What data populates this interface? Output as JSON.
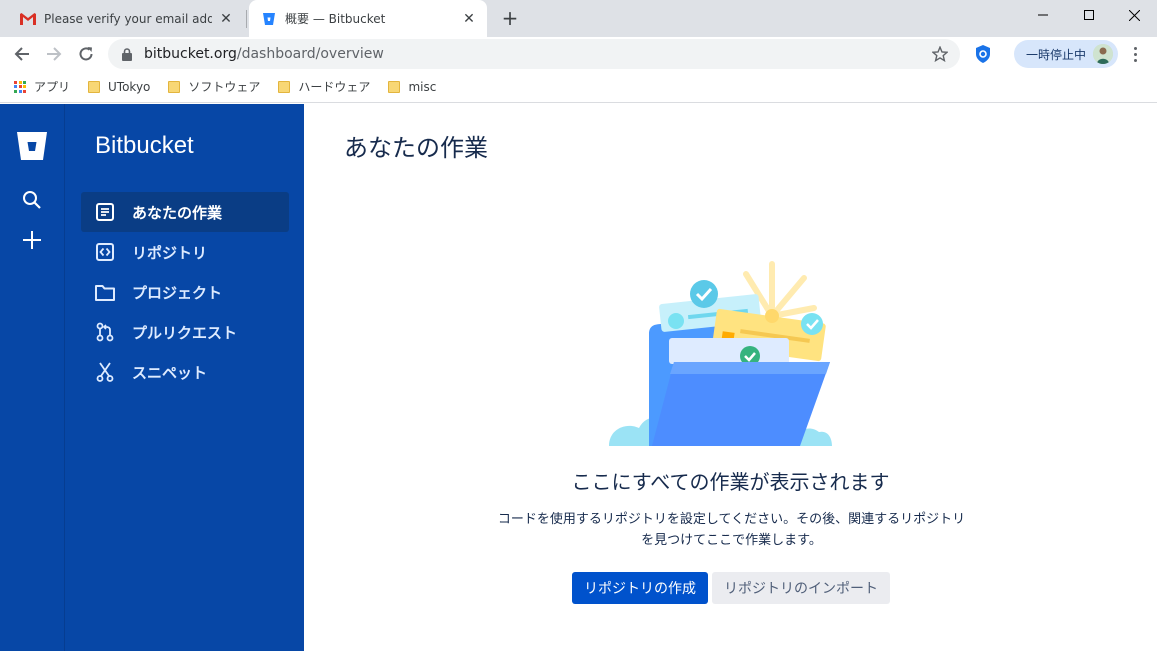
{
  "browser": {
    "tabs": [
      {
        "title": "Please verify your email address",
        "active": false,
        "favicon": "gmail-icon"
      },
      {
        "title": "概要 — Bitbucket",
        "active": true,
        "favicon": "bitbucket-icon"
      }
    ],
    "url": {
      "domain": "bitbucket.org",
      "path": "/dashboard/overview"
    },
    "profile_label": "一時停止中",
    "bookmarks": [
      {
        "label": "アプリ",
        "icon": "apps-grid-icon"
      },
      {
        "label": "UTokyo",
        "icon": "folder-icon"
      },
      {
        "label": "ソフトウェア",
        "icon": "folder-icon"
      },
      {
        "label": "ハードウェア",
        "icon": "folder-icon"
      },
      {
        "label": "misc",
        "icon": "folder-icon"
      }
    ]
  },
  "app": {
    "product_name": "Bitbucket",
    "sidebar": {
      "items": [
        {
          "label": "あなたの作業",
          "icon": "document-icon",
          "selected": true
        },
        {
          "label": "リポジトリ",
          "icon": "code-icon",
          "selected": false
        },
        {
          "label": "プロジェクト",
          "icon": "folder-icon",
          "selected": false
        },
        {
          "label": "プルリクエスト",
          "icon": "pull-request-icon",
          "selected": false
        },
        {
          "label": "スニペット",
          "icon": "scissors-icon",
          "selected": false
        }
      ]
    },
    "main": {
      "title": "あなたの作業",
      "empty_state": {
        "heading": "ここにすべての作業が表示されます",
        "description": "コードを使用するリポジトリを設定してください。その後、関連するリポジトリを見つけてここで作業します。",
        "primary_button": "リポジトリの作成",
        "secondary_button": "リポジトリのインポート"
      }
    }
  },
  "colors": {
    "sidebar_bg": "#0747a6",
    "selected_item_bg": "#0a3d85",
    "primary_button": "#0052cc",
    "secondary_button": "#ebecf0"
  }
}
